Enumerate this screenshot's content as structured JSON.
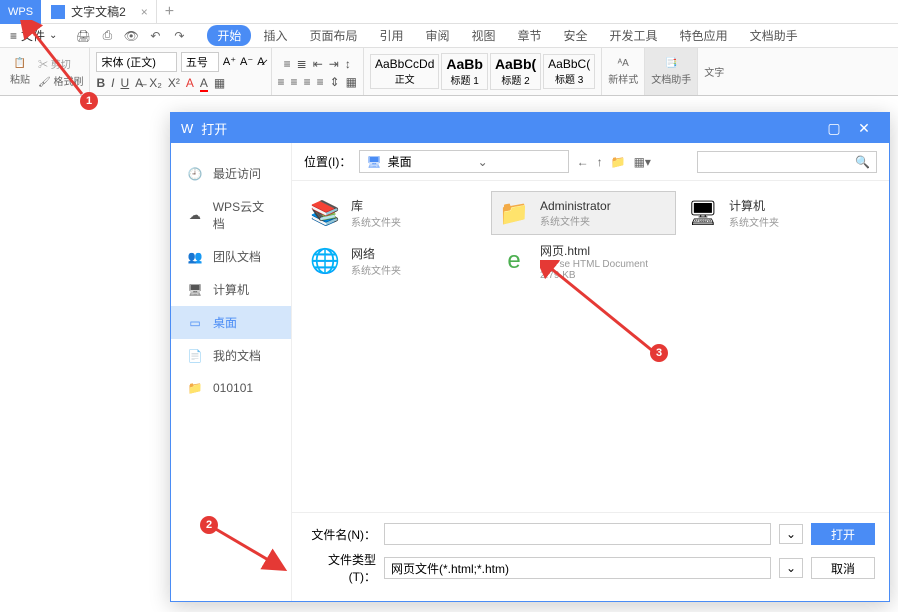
{
  "titlebar": {
    "wps": "WPS",
    "doc_name": "文字文稿2"
  },
  "menubar": {
    "file": "文件",
    "tabs": [
      "开始",
      "插入",
      "页面布局",
      "引用",
      "审阅",
      "视图",
      "章节",
      "安全",
      "开发工具",
      "特色应用",
      "文档助手"
    ]
  },
  "ribbon": {
    "paste": "粘贴",
    "cut": "剪切",
    "format_painter": "格式刷",
    "font": "宋体 (正文)",
    "size": "五号",
    "styles": {
      "s1": {
        "preview": "AaBbCcDd",
        "name": "正文"
      },
      "s2": {
        "preview": "AaBb",
        "name": "标题 1"
      },
      "s3": {
        "preview": "AaBb(",
        "name": "标题 2"
      },
      "s4": {
        "preview": "AaBbC(",
        "name": "标题 3"
      }
    },
    "new_style": "新样式",
    "doc_helper": "文档助手",
    "text": "文字"
  },
  "dialog": {
    "title": "打开",
    "sidebar": {
      "recent": "最近访问",
      "cloud": "WPS云文档",
      "team": "团队文档",
      "computer": "计算机",
      "desktop": "桌面",
      "mydocs": "我的文档",
      "folder": "010101"
    },
    "location": {
      "label": "位置(I)：",
      "value": "桌面"
    },
    "files": {
      "lib": {
        "name": "库",
        "meta": "系统文件夹"
      },
      "admin": {
        "name": "Administrator",
        "meta": "系统文件夹"
      },
      "pc": {
        "name": "计算机",
        "meta": "系统文件夹"
      },
      "net": {
        "name": "网络",
        "meta": "系统文件夹"
      },
      "html": {
        "name": "网页.html",
        "meta": "360 se HTML Document",
        "size": "2.79 KB"
      }
    },
    "footer": {
      "filename_label": "文件名(N)：",
      "filename_value": "",
      "filetype_label": "文件类型(T)：",
      "filetype_value": "网页文件(*.html;*.htm)",
      "open": "打开",
      "cancel": "取消"
    }
  },
  "annotations": {
    "a1": "1",
    "a2": "2",
    "a3": "3"
  }
}
